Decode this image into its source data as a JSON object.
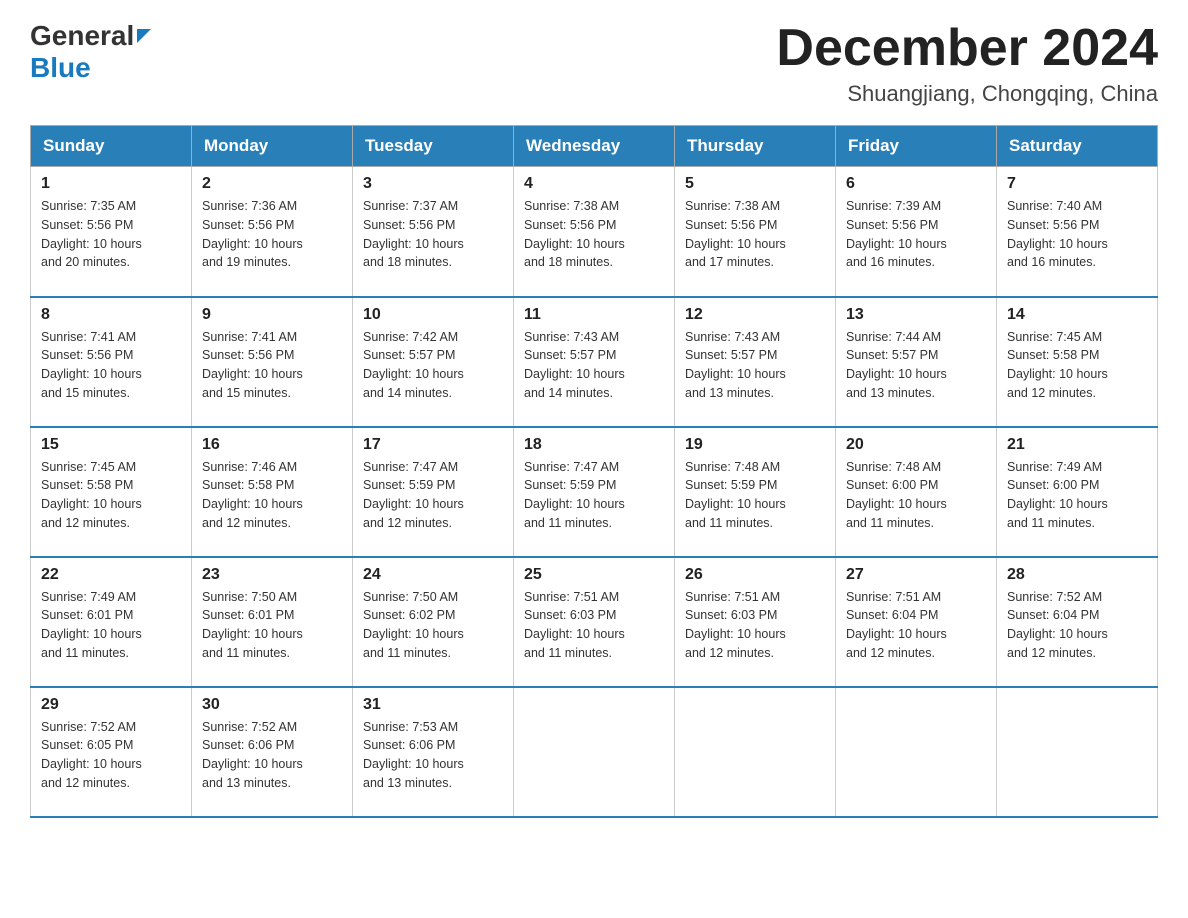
{
  "header": {
    "logo_general": "General",
    "logo_blue": "Blue",
    "month_title": "December 2024",
    "subtitle": "Shuangjiang, Chongqing, China"
  },
  "weekdays": [
    "Sunday",
    "Monday",
    "Tuesday",
    "Wednesday",
    "Thursday",
    "Friday",
    "Saturday"
  ],
  "weeks": [
    [
      {
        "day": "1",
        "sunrise": "7:35 AM",
        "sunset": "5:56 PM",
        "daylight": "10 hours and 20 minutes."
      },
      {
        "day": "2",
        "sunrise": "7:36 AM",
        "sunset": "5:56 PM",
        "daylight": "10 hours and 19 minutes."
      },
      {
        "day": "3",
        "sunrise": "7:37 AM",
        "sunset": "5:56 PM",
        "daylight": "10 hours and 18 minutes."
      },
      {
        "day": "4",
        "sunrise": "7:38 AM",
        "sunset": "5:56 PM",
        "daylight": "10 hours and 18 minutes."
      },
      {
        "day": "5",
        "sunrise": "7:38 AM",
        "sunset": "5:56 PM",
        "daylight": "10 hours and 17 minutes."
      },
      {
        "day": "6",
        "sunrise": "7:39 AM",
        "sunset": "5:56 PM",
        "daylight": "10 hours and 16 minutes."
      },
      {
        "day": "7",
        "sunrise": "7:40 AM",
        "sunset": "5:56 PM",
        "daylight": "10 hours and 16 minutes."
      }
    ],
    [
      {
        "day": "8",
        "sunrise": "7:41 AM",
        "sunset": "5:56 PM",
        "daylight": "10 hours and 15 minutes."
      },
      {
        "day": "9",
        "sunrise": "7:41 AM",
        "sunset": "5:56 PM",
        "daylight": "10 hours and 15 minutes."
      },
      {
        "day": "10",
        "sunrise": "7:42 AM",
        "sunset": "5:57 PM",
        "daylight": "10 hours and 14 minutes."
      },
      {
        "day": "11",
        "sunrise": "7:43 AM",
        "sunset": "5:57 PM",
        "daylight": "10 hours and 14 minutes."
      },
      {
        "day": "12",
        "sunrise": "7:43 AM",
        "sunset": "5:57 PM",
        "daylight": "10 hours and 13 minutes."
      },
      {
        "day": "13",
        "sunrise": "7:44 AM",
        "sunset": "5:57 PM",
        "daylight": "10 hours and 13 minutes."
      },
      {
        "day": "14",
        "sunrise": "7:45 AM",
        "sunset": "5:58 PM",
        "daylight": "10 hours and 12 minutes."
      }
    ],
    [
      {
        "day": "15",
        "sunrise": "7:45 AM",
        "sunset": "5:58 PM",
        "daylight": "10 hours and 12 minutes."
      },
      {
        "day": "16",
        "sunrise": "7:46 AM",
        "sunset": "5:58 PM",
        "daylight": "10 hours and 12 minutes."
      },
      {
        "day": "17",
        "sunrise": "7:47 AM",
        "sunset": "5:59 PM",
        "daylight": "10 hours and 12 minutes."
      },
      {
        "day": "18",
        "sunrise": "7:47 AM",
        "sunset": "5:59 PM",
        "daylight": "10 hours and 11 minutes."
      },
      {
        "day": "19",
        "sunrise": "7:48 AM",
        "sunset": "5:59 PM",
        "daylight": "10 hours and 11 minutes."
      },
      {
        "day": "20",
        "sunrise": "7:48 AM",
        "sunset": "6:00 PM",
        "daylight": "10 hours and 11 minutes."
      },
      {
        "day": "21",
        "sunrise": "7:49 AM",
        "sunset": "6:00 PM",
        "daylight": "10 hours and 11 minutes."
      }
    ],
    [
      {
        "day": "22",
        "sunrise": "7:49 AM",
        "sunset": "6:01 PM",
        "daylight": "10 hours and 11 minutes."
      },
      {
        "day": "23",
        "sunrise": "7:50 AM",
        "sunset": "6:01 PM",
        "daylight": "10 hours and 11 minutes."
      },
      {
        "day": "24",
        "sunrise": "7:50 AM",
        "sunset": "6:02 PM",
        "daylight": "10 hours and 11 minutes."
      },
      {
        "day": "25",
        "sunrise": "7:51 AM",
        "sunset": "6:03 PM",
        "daylight": "10 hours and 11 minutes."
      },
      {
        "day": "26",
        "sunrise": "7:51 AM",
        "sunset": "6:03 PM",
        "daylight": "10 hours and 12 minutes."
      },
      {
        "day": "27",
        "sunrise": "7:51 AM",
        "sunset": "6:04 PM",
        "daylight": "10 hours and 12 minutes."
      },
      {
        "day": "28",
        "sunrise": "7:52 AM",
        "sunset": "6:04 PM",
        "daylight": "10 hours and 12 minutes."
      }
    ],
    [
      {
        "day": "29",
        "sunrise": "7:52 AM",
        "sunset": "6:05 PM",
        "daylight": "10 hours and 12 minutes."
      },
      {
        "day": "30",
        "sunrise": "7:52 AM",
        "sunset": "6:06 PM",
        "daylight": "10 hours and 13 minutes."
      },
      {
        "day": "31",
        "sunrise": "7:53 AM",
        "sunset": "6:06 PM",
        "daylight": "10 hours and 13 minutes."
      },
      null,
      null,
      null,
      null
    ]
  ],
  "labels": {
    "sunrise": "Sunrise:",
    "sunset": "Sunset:",
    "daylight": "Daylight:"
  }
}
